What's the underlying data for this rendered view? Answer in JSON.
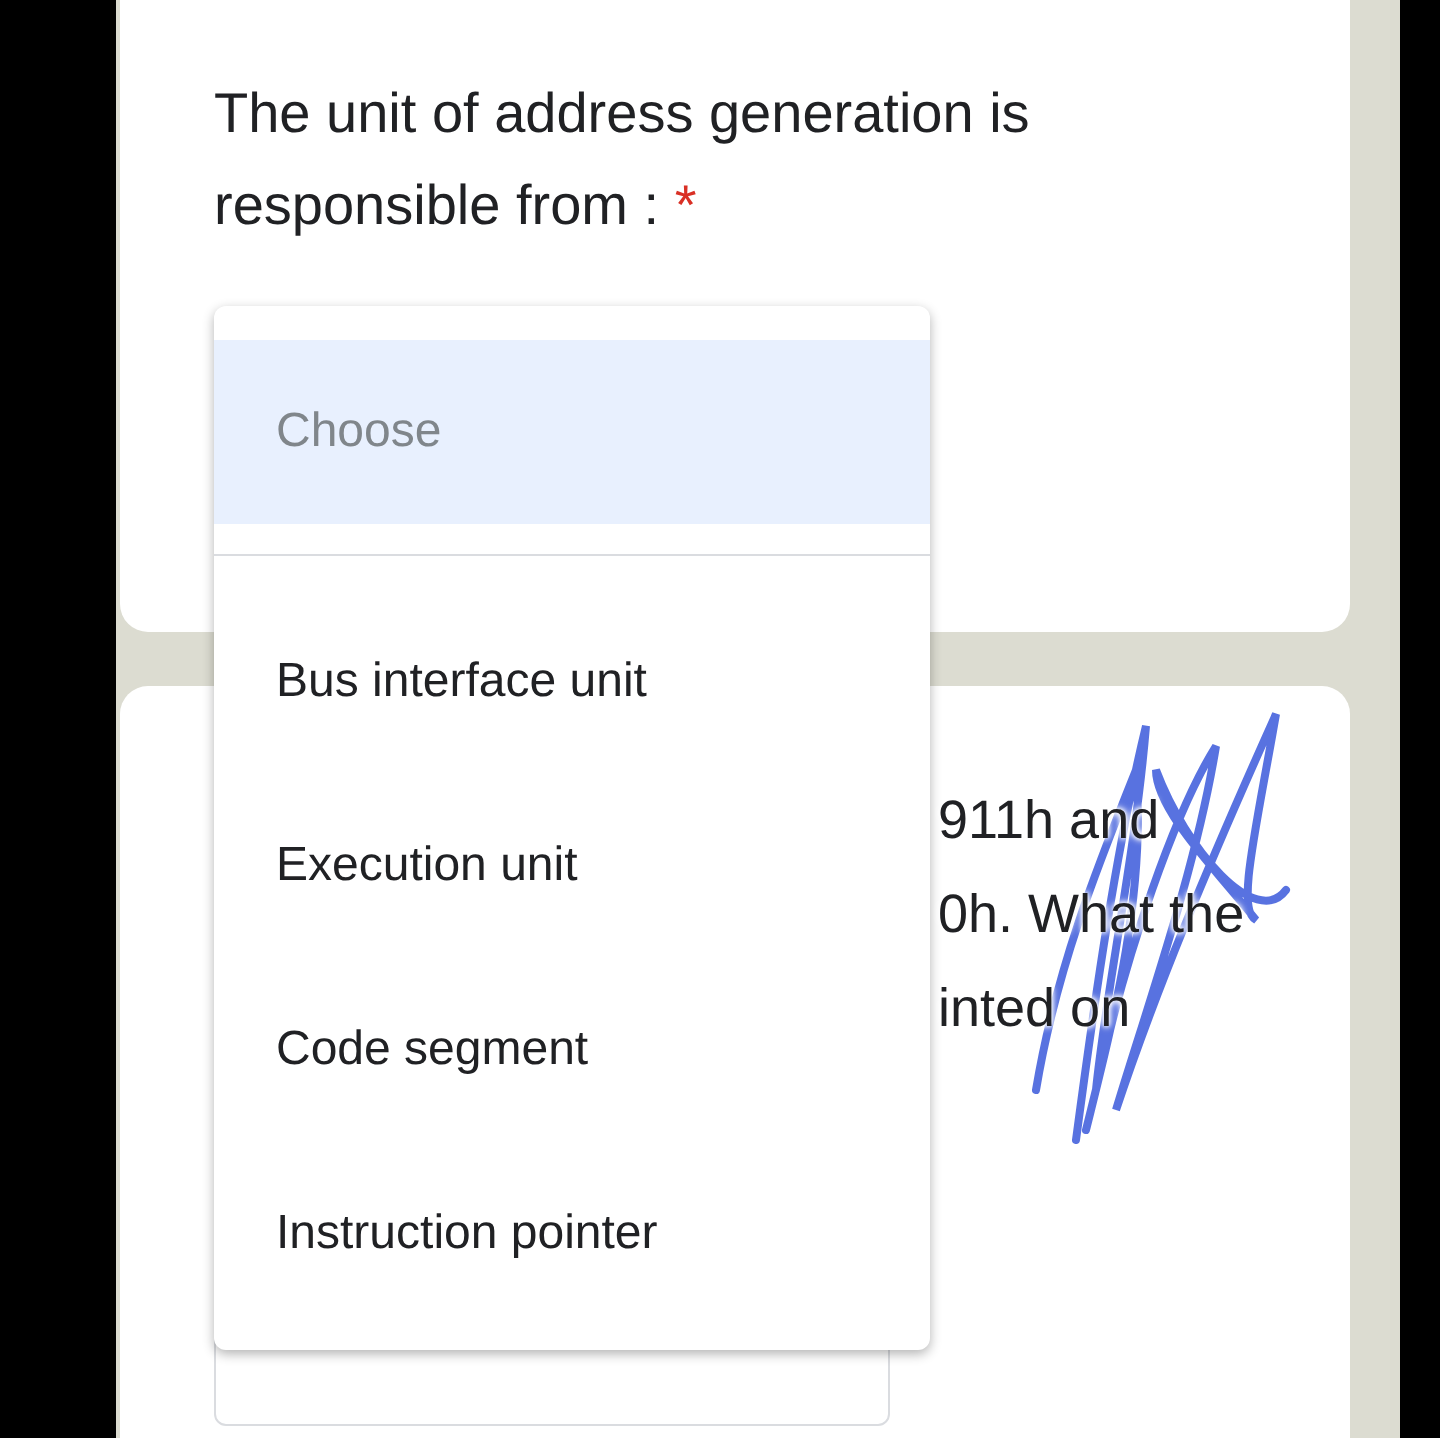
{
  "question": {
    "text": "The unit of address generation is responsible from :",
    "required_mark": "*"
  },
  "dropdown": {
    "placeholder": "Choose",
    "options": [
      {
        "label": "Bus interface unit",
        "selected": false
      },
      {
        "label": "Execution unit",
        "selected": false
      },
      {
        "label": "Code segment",
        "selected": false
      },
      {
        "label": "Instruction pointer",
        "selected": false
      }
    ]
  },
  "next_question": {
    "lines": [
      "911h and",
      "0h. What the",
      "inted on"
    ]
  }
}
